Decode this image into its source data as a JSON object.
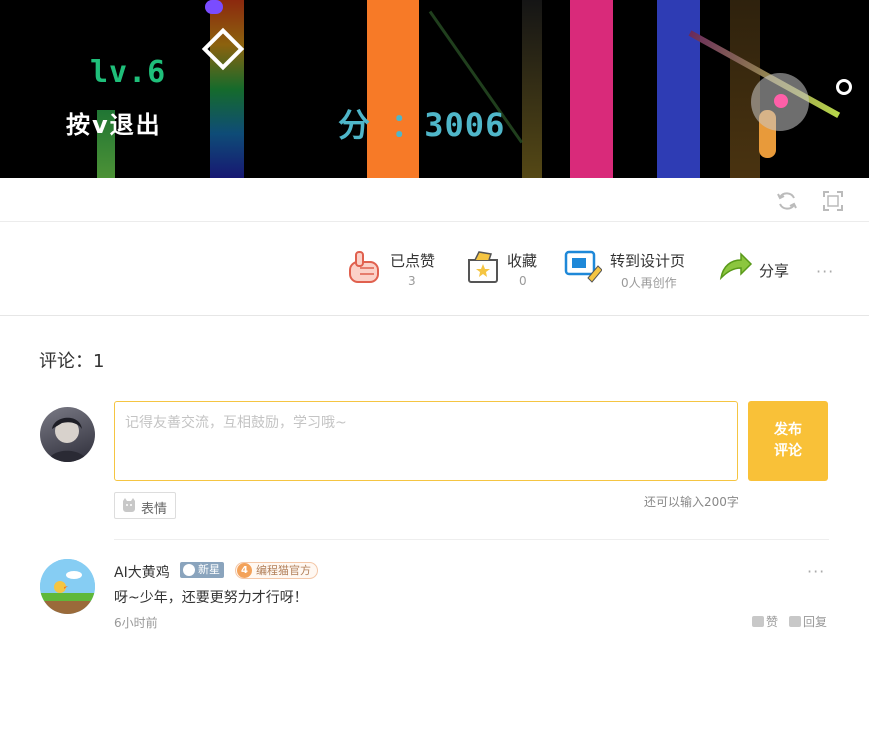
{
  "game": {
    "level_text": "lv.6",
    "exit_hint": "按v退出",
    "score_text": "分  ：3006"
  },
  "actions": {
    "like": {
      "label": "已点赞",
      "count": "3"
    },
    "favorite": {
      "label": "收藏",
      "count": "0"
    },
    "remix": {
      "label": "转到设计页",
      "sub": "0人再创作"
    },
    "share": {
      "label": "分享"
    },
    "more": "···"
  },
  "comments": {
    "count_label": "评论：1",
    "input_placeholder": "记得友善交流，互相鼓励，学习哦~",
    "publish_label_line1": "发布",
    "publish_label_line2": "评论",
    "emoji_label": "表情",
    "remaining_chars": "还可以输入200字",
    "items": [
      {
        "author": "AI大黄鸡",
        "badge_new": "新星",
        "badge_official_level": "4",
        "badge_official": "编程猫官方",
        "text": "呀~少年，还要更努力才行呀！",
        "time": "6小时前",
        "like_label": "赞",
        "reply_label": "回复",
        "more": "···"
      }
    ]
  },
  "colors": {
    "accent": "#f9c138",
    "input_border": "#f5c542",
    "level_green": "#1fbf7a",
    "score_cyan": "#4fb6c9"
  }
}
